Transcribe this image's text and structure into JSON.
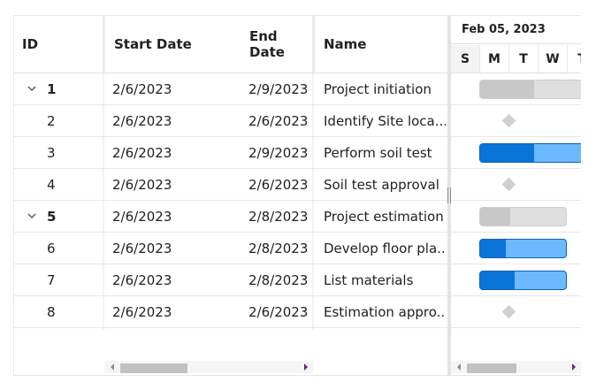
{
  "grid": {
    "columns": {
      "id": "ID",
      "start": "Start Date",
      "end": "End Date",
      "name": "Name"
    },
    "rows": [
      {
        "id": "1",
        "start": "2/6/2023",
        "end": "2/9/2023",
        "name": "Project initiation",
        "parent": true,
        "expanded": true
      },
      {
        "id": "2",
        "start": "2/6/2023",
        "end": "2/6/2023",
        "name": "Identify Site loca...",
        "parent": false
      },
      {
        "id": "3",
        "start": "2/6/2023",
        "end": "2/9/2023",
        "name": "Perform soil test",
        "parent": false
      },
      {
        "id": "4",
        "start": "2/6/2023",
        "end": "2/6/2023",
        "name": "Soil test approval",
        "parent": false
      },
      {
        "id": "5",
        "start": "2/6/2023",
        "end": "2/8/2023",
        "name": "Project estimation",
        "parent": true,
        "expanded": true
      },
      {
        "id": "6",
        "start": "2/6/2023",
        "end": "2/8/2023",
        "name": "Develop floor pla...",
        "parent": false
      },
      {
        "id": "7",
        "start": "2/6/2023",
        "end": "2/8/2023",
        "name": "List materials",
        "parent": false
      },
      {
        "id": "8",
        "start": "2/6/2023",
        "end": "2/6/2023",
        "name": "Estimation appro...",
        "parent": false
      }
    ]
  },
  "timeline": {
    "week_label": "Feb 05, 2023",
    "days": [
      "S",
      "M",
      "T",
      "W",
      "T"
    ]
  },
  "tasks": [
    {
      "row": 1,
      "type": "parent",
      "progress": 0.47
    },
    {
      "row": 2,
      "type": "milestone"
    },
    {
      "row": 3,
      "type": "child",
      "progress": 0.47
    },
    {
      "row": 4,
      "type": "milestone"
    },
    {
      "row": 5,
      "type": "parent",
      "progress": 0.35
    },
    {
      "row": 6,
      "type": "child",
      "progress": 0.3
    },
    {
      "row": 7,
      "type": "child",
      "progress": 0.4
    },
    {
      "row": 8,
      "type": "milestone"
    }
  ],
  "colors": {
    "progress_dark": "#0a75d6",
    "progress_light": "#6cb9ff",
    "parent_bar": "#dfdfdf",
    "milestone": "#d0d0d0"
  },
  "icons": {
    "expand": "chevron-down-icon",
    "scroll_left": "caret-left-icon",
    "scroll_right": "caret-right-icon"
  }
}
